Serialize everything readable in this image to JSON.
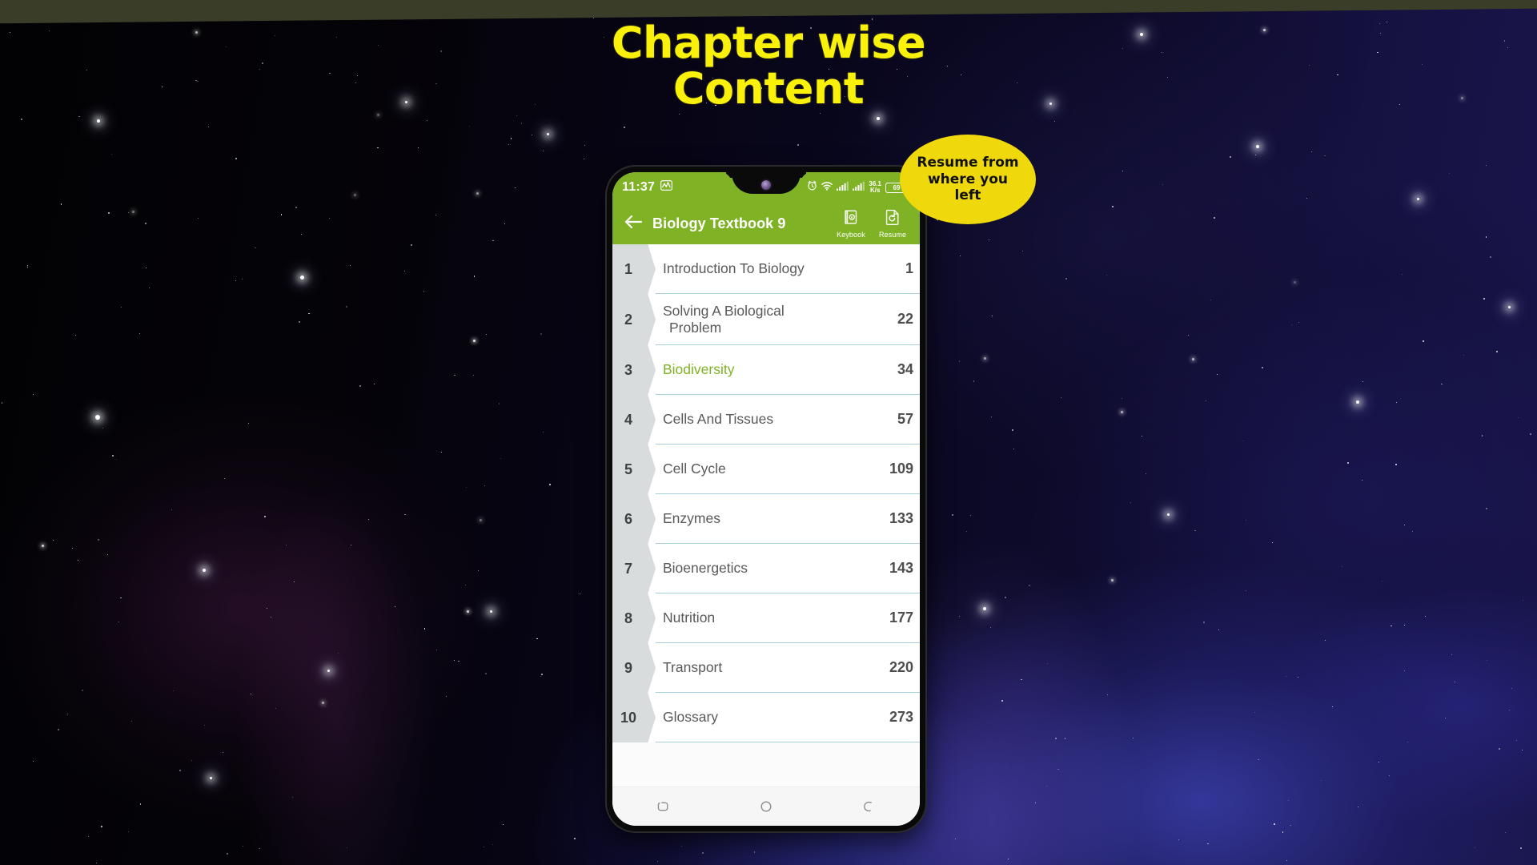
{
  "headline": {
    "line1": "Chapter wise",
    "line2": "Content",
    "color": "#f9f10a"
  },
  "callout": {
    "text": "Resume from\nwhere you\nleft",
    "bg_color": "#efd80b",
    "text_color": "#111111"
  },
  "phone": {
    "status_bar": {
      "time": "11:37",
      "activity_icon": "chart-activity-icon",
      "alarm_icon": "alarm-clock-icon",
      "wifi_icon": "wifi-icon",
      "signal_icon_1": "signal-bars-icon",
      "signal_icon_2": "signal-bars-icon",
      "net_speed_value": "36.1",
      "net_speed_unit": "K/s",
      "battery_level": "69",
      "bg_color": "#7fb325"
    },
    "app_bar": {
      "back_label": "back",
      "title": "Biology Textbook 9",
      "actions": [
        {
          "name": "keybook",
          "label": "Keybook",
          "icon": "book-k-icon"
        },
        {
          "name": "resume",
          "label": "Resume",
          "icon": "resume-page-icon"
        }
      ],
      "bg_color": "#7fb325"
    },
    "chapters": {
      "items": [
        {
          "number": "1",
          "title": "Introduction To Biology",
          "page": "1",
          "active": false
        },
        {
          "number": "2",
          "title": "Solving A Biological\nProblem",
          "page": "22",
          "active": false
        },
        {
          "number": "3",
          "title": "Biodiversity",
          "page": "34",
          "active": true
        },
        {
          "number": "4",
          "title": "Cells And Tissues",
          "page": "57",
          "active": false
        },
        {
          "number": "5",
          "title": "Cell Cycle",
          "page": "109",
          "active": false
        },
        {
          "number": "6",
          "title": "Enzymes",
          "page": "133",
          "active": false
        },
        {
          "number": "7",
          "title": "Bioenergetics",
          "page": "143",
          "active": false
        },
        {
          "number": "8",
          "title": "Nutrition",
          "page": "177",
          "active": false
        },
        {
          "number": "9",
          "title": "Transport",
          "page": "220",
          "active": false
        },
        {
          "number": "10",
          "title": "Glossary",
          "page": "273",
          "active": false
        }
      ],
      "active_color": "#7fb325",
      "divider_color": "#a9cfd8",
      "chip_color": "#d9dcdd"
    },
    "nav_bar": {
      "recents_icon": "recents-icon",
      "home_icon": "home-circle-icon",
      "back_icon": "back-icon"
    }
  }
}
